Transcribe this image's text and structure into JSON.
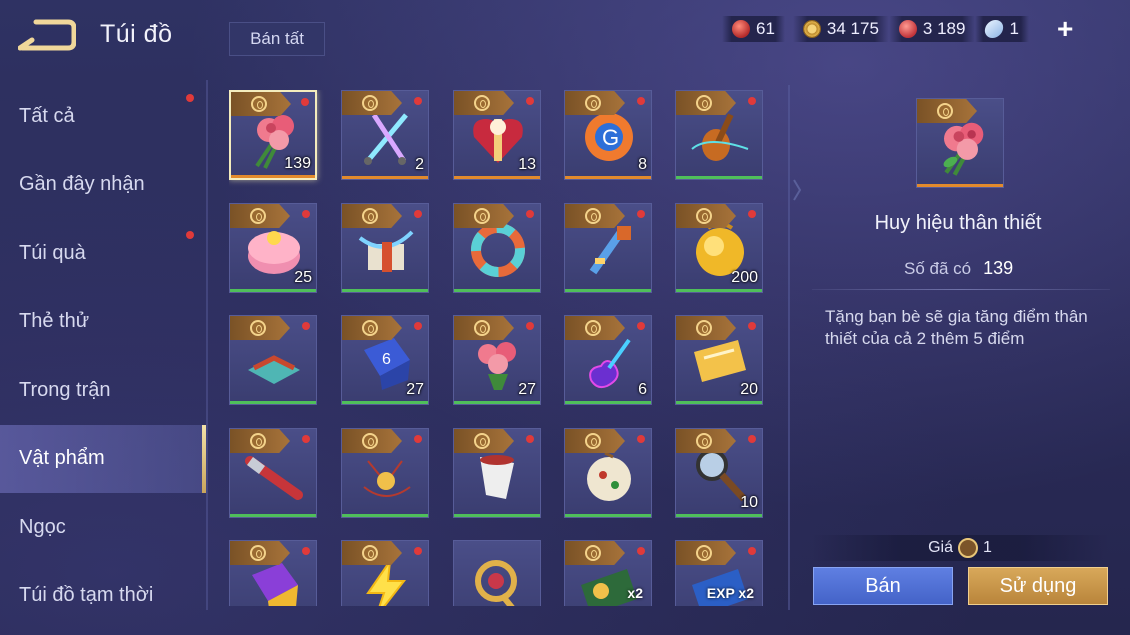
{
  "header": {
    "title": "Túi đồ",
    "sell_all_label": "Bán tất"
  },
  "currencies": [
    {
      "icon": "ruby-icon",
      "value": "61"
    },
    {
      "icon": "gold-coin-icon",
      "value": "34 175"
    },
    {
      "icon": "red-gem-icon",
      "value": "3 189"
    },
    {
      "icon": "card-icon",
      "value": "1"
    }
  ],
  "sidebar": {
    "items": [
      {
        "label": "Tất cả",
        "dot": true
      },
      {
        "label": "Gần đây nhận",
        "dot": false
      },
      {
        "label": "Túi quà",
        "dot": true
      },
      {
        "label": "Thẻ thử",
        "dot": false
      },
      {
        "label": "Trong trận",
        "dot": false
      },
      {
        "label": "Vật phẩm",
        "dot": false,
        "active": true
      },
      {
        "label": "Ngọc",
        "dot": false
      },
      {
        "label": "Túi đồ tạm thời",
        "dot": false
      }
    ]
  },
  "grid": {
    "items": [
      {
        "name": "rose-bouquet",
        "count": "139",
        "bar": "orange",
        "selected": true
      },
      {
        "name": "crossed-swords",
        "count": "2",
        "bar": "orange"
      },
      {
        "name": "heart-gift-box",
        "count": "13",
        "bar": "orange"
      },
      {
        "name": "orange-badge",
        "count": "8",
        "bar": "orange"
      },
      {
        "name": "magic-lute",
        "count": "",
        "bar": "green"
      },
      {
        "name": "pink-cake",
        "count": "25",
        "bar": "green"
      },
      {
        "name": "ribbon-chest",
        "count": "",
        "bar": "green"
      },
      {
        "name": "lifebuoy-ring",
        "count": "",
        "bar": "green"
      },
      {
        "name": "golden-key",
        "count": "",
        "bar": "green"
      },
      {
        "name": "gold-orb",
        "count": "200",
        "bar": "green"
      },
      {
        "name": "stage-platform",
        "count": "",
        "bar": "green"
      },
      {
        "name": "blue-dice",
        "count": "27",
        "bar": "green"
      },
      {
        "name": "flower-basket",
        "count": "27",
        "bar": "green"
      },
      {
        "name": "neon-guitar",
        "count": "6",
        "bar": "green"
      },
      {
        "name": "gold-ticket",
        "count": "20",
        "bar": "green"
      },
      {
        "name": "utility-knife",
        "count": "",
        "bar": "green"
      },
      {
        "name": "coin-necklace",
        "count": "",
        "bar": "green"
      },
      {
        "name": "paper-cup",
        "count": "",
        "bar": "green"
      },
      {
        "name": "christmas-ornament",
        "count": "",
        "bar": "green"
      },
      {
        "name": "magnifier",
        "count": "10",
        "bar": "green"
      },
      {
        "name": "purple-dice",
        "count": "",
        "bar": "none"
      },
      {
        "name": "lightning-bolt",
        "count": "",
        "bar": "none"
      },
      {
        "name": "golden-scepter",
        "count": "",
        "bar": "none",
        "tag": false
      },
      {
        "name": "gold-x2-card",
        "count": "",
        "bar": "none",
        "label": "x2"
      },
      {
        "name": "exp-x2-card",
        "count": "",
        "bar": "none",
        "label": "EXP x2"
      }
    ]
  },
  "detail": {
    "name": "Huy hiệu thân thiết",
    "owned_label": "Số đã có",
    "owned_value": "139",
    "description": "Tặng bạn bè sẽ gia tăng điểm thân thiết của cả 2 thêm 5 điểm",
    "price_label": "Giá",
    "price_value": "1",
    "sell_label": "Bán",
    "use_label": "Sử dụng"
  }
}
